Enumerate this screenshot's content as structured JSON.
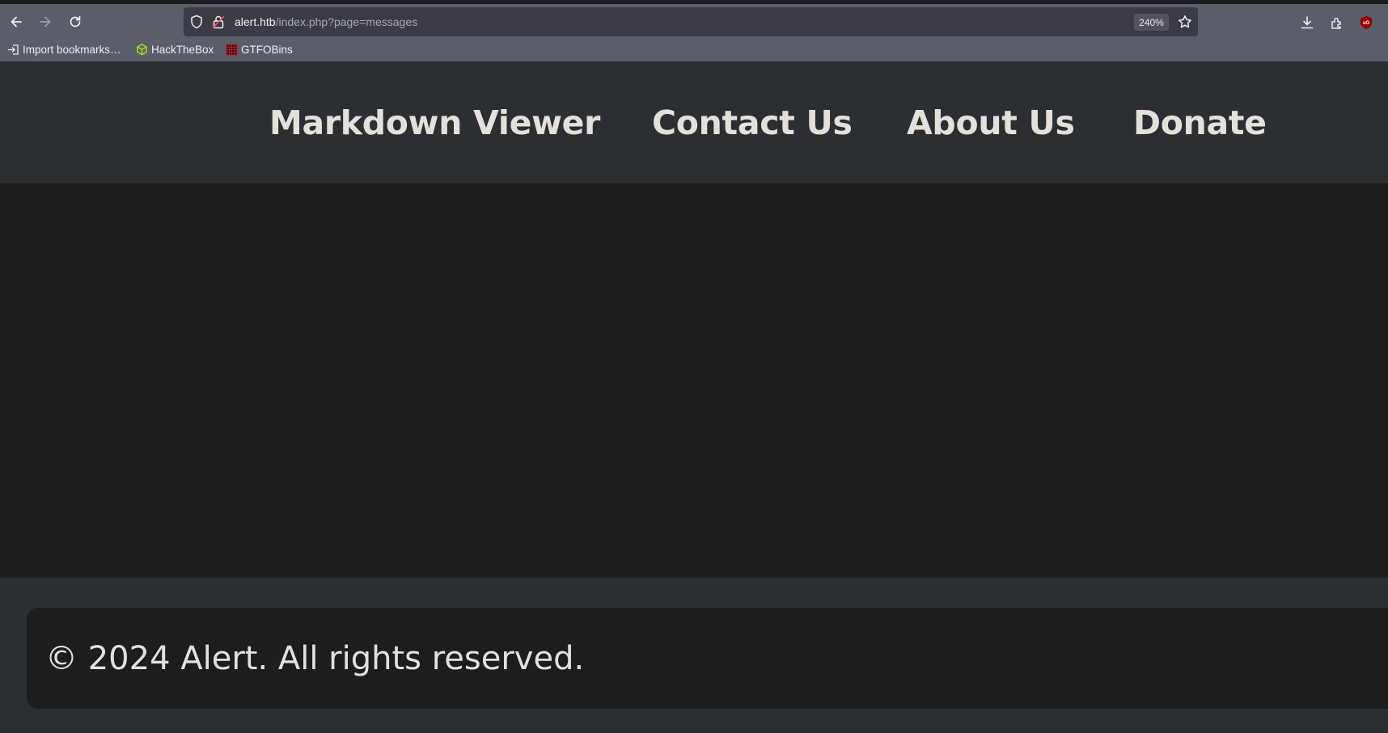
{
  "browser": {
    "url_host": "alert.htb",
    "url_path": "/index.php?page=messages",
    "zoom_level": "240%",
    "icons": {
      "back": "back-arrow-icon",
      "forward": "forward-arrow-icon",
      "reload": "reload-icon",
      "tracking_protection": "shield-icon",
      "connection": "insecure-lock-icon",
      "bookmark_star": "star-icon",
      "downloads": "download-icon",
      "extensions": "extensions-icon",
      "ublock": "ublock-origin-icon"
    },
    "bookmarks": [
      {
        "label": "Import bookmarks…",
        "icon": "import-icon"
      },
      {
        "label": "HackTheBox",
        "icon": "hackthebox-cube-icon"
      },
      {
        "label": "GTFOBins",
        "icon": "gtfobins-grid-icon"
      }
    ]
  },
  "site": {
    "nav": [
      {
        "label": "Markdown Viewer"
      },
      {
        "label": "Contact Us"
      },
      {
        "label": "About Us"
      },
      {
        "label": "Donate"
      }
    ],
    "footer": {
      "copyright": "© 2024 Alert. All rights reserved."
    }
  },
  "colors": {
    "browser_toolbar": "#5a5d6a",
    "urlbar": "#3a3b44",
    "page_header": "#2b2e32",
    "page_main": "#1b1d1f",
    "text": "#e4e0da",
    "hackthebox_green": "#9fef00",
    "gtfobins_red": "#b3202a"
  }
}
